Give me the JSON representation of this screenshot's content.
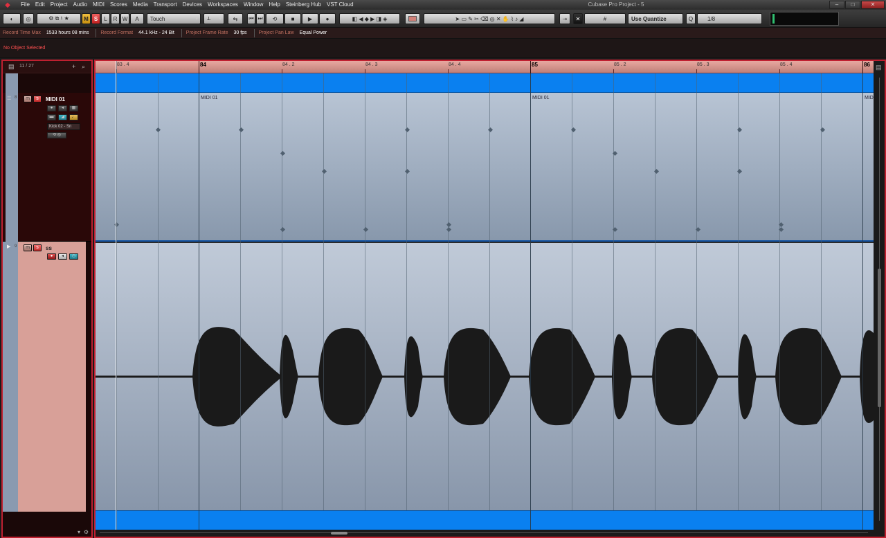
{
  "window": {
    "title": "Cubase Pro Project - 5",
    "buttons": [
      "–",
      "□",
      "✕"
    ]
  },
  "menu": [
    "File",
    "Edit",
    "Project",
    "Audio",
    "MIDI",
    "Scores",
    "Media",
    "Transport",
    "Devices",
    "Workspaces",
    "Window",
    "Help",
    "Steinberg Hub",
    "VST Cloud"
  ],
  "toolbar": {
    "m_label": "M",
    "s_label": "S",
    "l_label": "L",
    "r_label": "R",
    "w_label": "W",
    "a_label": "A",
    "automation_mode": "Touch",
    "quantize_mode": "Use Quantize",
    "quantize_value": "1/8",
    "q_label": "Q"
  },
  "status": {
    "record_time_max_label": "Record Time Max",
    "record_time_max_value": "1533 hours 08 mins",
    "record_format_label": "Record Format",
    "record_format_value": "44.1 kHz - 24 Bit",
    "frame_rate_label": "Project Frame Rate",
    "frame_rate_value": "30 fps",
    "pan_law_label": "Project Pan Law",
    "pan_law_value": "Equal Power"
  },
  "info_line": {
    "object_status": "No Object Selected"
  },
  "track_list": {
    "count": "11 / 27",
    "tracks": [
      {
        "name": "MIDI 01",
        "type": "midi",
        "number": "8",
        "instrument": "Kick 02 - Sn"
      },
      {
        "name": "ss",
        "type": "audio",
        "number": "9"
      }
    ]
  },
  "ruler": {
    "bars": [
      "84",
      "85",
      "86"
    ],
    "beats": [
      "83 . 4",
      "84 . 2",
      "84 . 3",
      "84 . 4",
      "85 . 2",
      "85 . 3",
      "85 . 4"
    ]
  },
  "midi_parts": [
    "MIDI 01",
    "MIDI 01",
    "MIDI"
  ],
  "colors": {
    "accent_red": "#c02030",
    "loop_blue": "#0a80f0",
    "ruler_pink": "#d89890",
    "audio_track": "#d8a098"
  }
}
